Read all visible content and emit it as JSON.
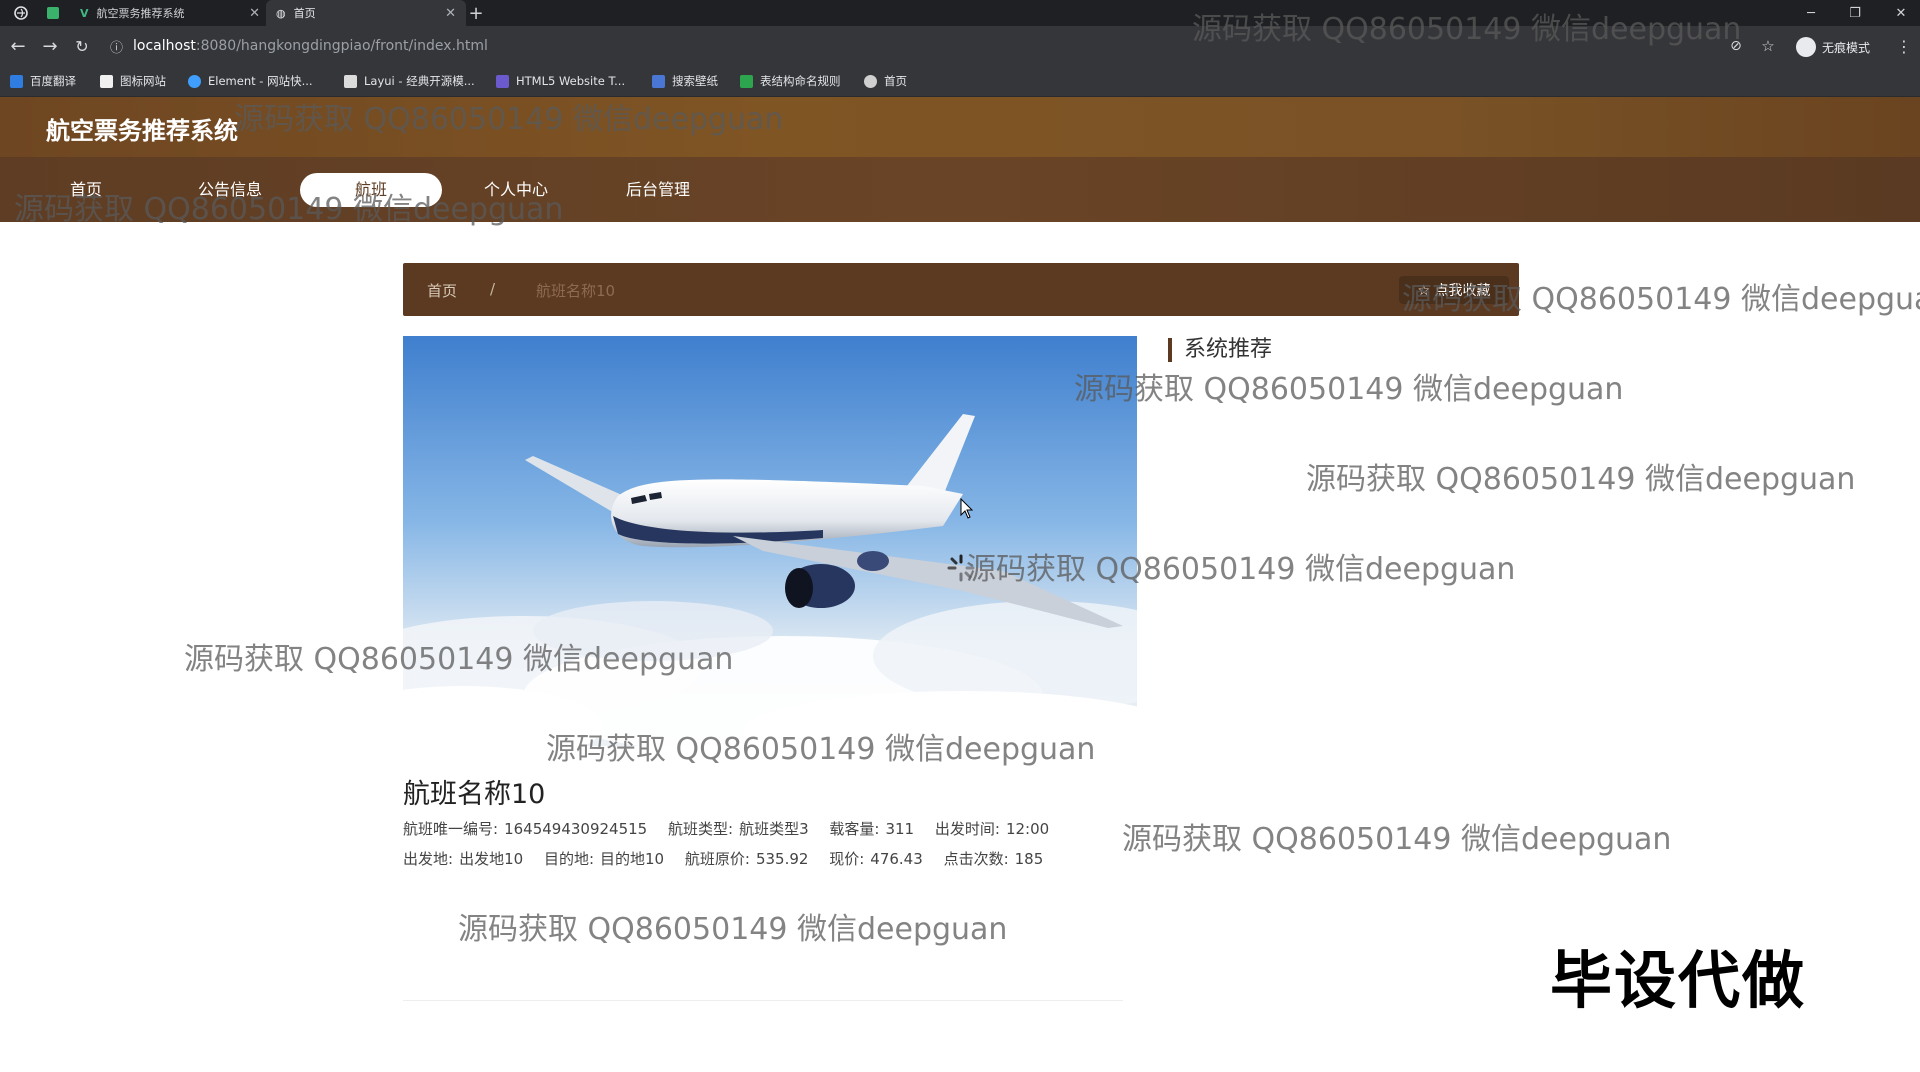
{
  "browser": {
    "tabs": [
      {
        "label": "航空票务推荐系统"
      },
      {
        "label": "首页"
      }
    ],
    "url_host": "localhost",
    "url_path": ":8080/hangkongdingpiao/front/index.html",
    "profile_label": "无痕模式",
    "bookmarks": [
      {
        "label": "百度翻译"
      },
      {
        "label": "图标网站"
      },
      {
        "label": "Element - 网站快..."
      },
      {
        "label": "Layui - 经典开源模..."
      },
      {
        "label": "HTML5 Website T..."
      },
      {
        "label": "搜索壁纸"
      },
      {
        "label": "表结构命名规则"
      },
      {
        "label": "首页"
      }
    ]
  },
  "site": {
    "title": "航空票务推荐系统",
    "nav": [
      {
        "label": "首页"
      },
      {
        "label": "公告信息"
      },
      {
        "label": "航班"
      },
      {
        "label": "个人中心"
      },
      {
        "label": "后台管理"
      }
    ]
  },
  "breadcrumb": {
    "home": "首页",
    "separator": "/",
    "current": "航班名称10",
    "favorite_label": "☆ 点我收藏"
  },
  "flight": {
    "name": "航班名称10",
    "fields_row1": [
      {
        "label": "航班唯一编号:",
        "value": "164549430924515"
      },
      {
        "label": "航班类型:",
        "value": "航班类型3"
      },
      {
        "label": "载客量:",
        "value": "311"
      },
      {
        "label": "出发时间:",
        "value": "12:00"
      }
    ],
    "fields_row2": [
      {
        "label": "出发地:",
        "value": "出发地10"
      },
      {
        "label": "目的地:",
        "value": "目的地10"
      },
      {
        "label": "航班原价:",
        "value": "535.92"
      },
      {
        "label": "现价:",
        "value": "476.43"
      },
      {
        "label": "点击次数:",
        "value": "185"
      }
    ]
  },
  "recommend": {
    "title": "系统推荐"
  },
  "watermark": "源码获取 QQ86050149 微信deepguan",
  "corner_text": "毕设代做",
  "colors": {
    "header_brown": "#7a5226",
    "nav_brown": "#5e3d24",
    "breadcrumb_bg": "#5b3a21"
  }
}
